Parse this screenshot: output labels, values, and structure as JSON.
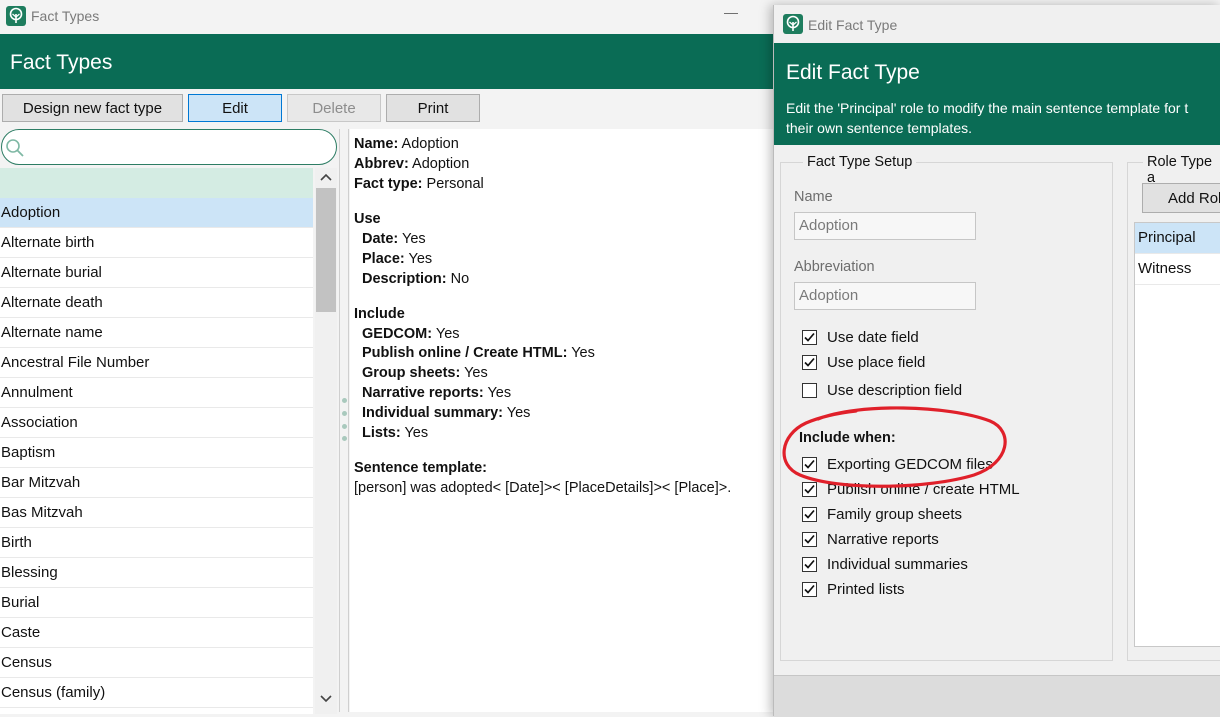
{
  "main_window": {
    "titlebar_title": "Fact Types",
    "minimize_symbol": "—",
    "header_title": "Fact Types",
    "toolbar": {
      "design_new": "Design new fact type",
      "edit": "Edit",
      "delete": "Delete",
      "print": "Print"
    },
    "search": {
      "placeholder": ""
    },
    "fact_list": [
      "Adoption",
      "Alternate birth",
      "Alternate burial",
      "Alternate death",
      "Alternate name",
      "Ancestral File Number",
      "Annulment",
      "Association",
      "Baptism",
      "Bar Mitzvah",
      "Bas Mitzvah",
      "Birth",
      "Blessing",
      "Burial",
      "Caste",
      "Census",
      "Census (family)"
    ],
    "selected_item": "Adoption"
  },
  "detail": {
    "name_label": "Name:",
    "name_value": " Adoption",
    "abbrev_label": "Abbrev:",
    "abbrev_value": " Adoption",
    "facttype_label": "Fact type:",
    "facttype_value": " Personal",
    "use_heading": "Use",
    "date_label": "Date:",
    "date_value": " Yes",
    "place_label": "Place:",
    "place_value": " Yes",
    "desc_label": "Description:",
    "desc_value": " No",
    "include_heading": "Include",
    "gedcom_label": "GEDCOM:",
    "gedcom_value": " Yes",
    "publish_label": "Publish online / Create HTML:",
    "publish_value": " Yes",
    "group_label": "Group sheets:",
    "group_value": " Yes",
    "narrative_label": "Narrative reports:",
    "narrative_value": " Yes",
    "individual_label": "Individual summary:",
    "individual_value": " Yes",
    "lists_label": "Lists:",
    "lists_value": " Yes",
    "template_heading": "Sentence template:",
    "template_value": "[person] was adopted< [Date]>< [PlaceDetails]>< [Place]>."
  },
  "dialog": {
    "titlebar_title": "Edit Fact Type",
    "header_title": "Edit Fact Type",
    "header_desc_1": "Edit the 'Principal' role to modify the main sentence template for t",
    "header_desc_2": "their own sentence templates.",
    "setup_legend": "Fact Type Setup",
    "name_label": "Name",
    "name_value": "Adoption",
    "abbrev_label": "Abbreviation",
    "abbrev_value": "Adoption",
    "use_date": "Use date field",
    "use_place": "Use place field",
    "use_desc": "Use description field",
    "include_when": "Include when:",
    "inc_gedcom": "Exporting GEDCOM files",
    "inc_publish": "Publish online / create HTML",
    "inc_family": "Family group sheets",
    "inc_narrative": "Narrative reports",
    "inc_individual": "Individual summaries",
    "inc_printed": "Printed lists",
    "role_legend": "Role Type a",
    "add_role": "Add Rol",
    "roles": [
      "Principal",
      "Witness"
    ],
    "checked": {
      "use_date": true,
      "use_place": true,
      "use_desc": false,
      "inc_gedcom": true,
      "inc_publish": true,
      "inc_family": true,
      "inc_narrative": true,
      "inc_individual": true,
      "inc_printed": true
    }
  },
  "colors": {
    "brand_green": "#0a6c55",
    "annotation_red": "#e0202a",
    "selection_blue": "#cce4f7"
  }
}
